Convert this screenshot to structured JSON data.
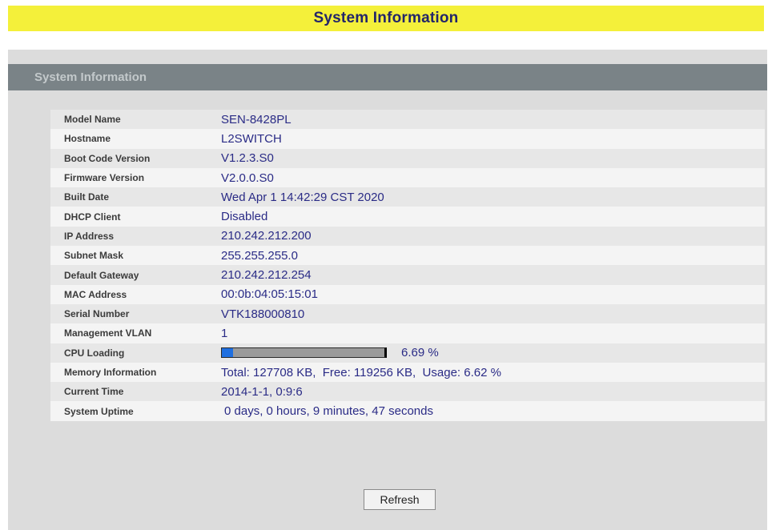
{
  "page_title": "System Information",
  "panel": {
    "title": "System Information"
  },
  "rows": [
    {
      "label": "Model Name",
      "value": "SEN-8428PL"
    },
    {
      "label": "Hostname",
      "value": "L2SWITCH"
    },
    {
      "label": "Boot Code Version",
      "value": "V1.2.3.S0"
    },
    {
      "label": "Firmware Version",
      "value": "V2.0.0.S0"
    },
    {
      "label": "Built Date",
      "value": "Wed Apr 1 14:42:29 CST 2020"
    },
    {
      "label": "DHCP Client",
      "value": "Disabled"
    },
    {
      "label": "IP Address",
      "value": "210.242.212.200"
    },
    {
      "label": "Subnet Mask",
      "value": "255.255.255.0"
    },
    {
      "label": "Default Gateway",
      "value": "210.242.212.254"
    },
    {
      "label": "MAC Address",
      "value": "00:0b:04:05:15:01"
    },
    {
      "label": "Serial Number",
      "value": "VTK188000810"
    },
    {
      "label": "Management VLAN",
      "value": "1"
    }
  ],
  "cpu": {
    "label": "CPU Loading",
    "text": "6.69 %",
    "percent": 6.69
  },
  "memory": {
    "label": "Memory Information",
    "value": "Total: 127708 KB,  Free: 119256 KB,  Usage: 6.62 %"
  },
  "current_time": {
    "label": "Current Time",
    "value": "2014-1-1, 0:9:6"
  },
  "uptime": {
    "label": "System Uptime",
    "value": "0 days, 0 hours, 9 minutes, 47 seconds"
  },
  "refresh_label": "Refresh",
  "colors": {
    "title_bar": "#f4f03a",
    "header": "#7a8387",
    "value_text": "#2a2b86",
    "cpu_fill": "#1f6fe0"
  }
}
